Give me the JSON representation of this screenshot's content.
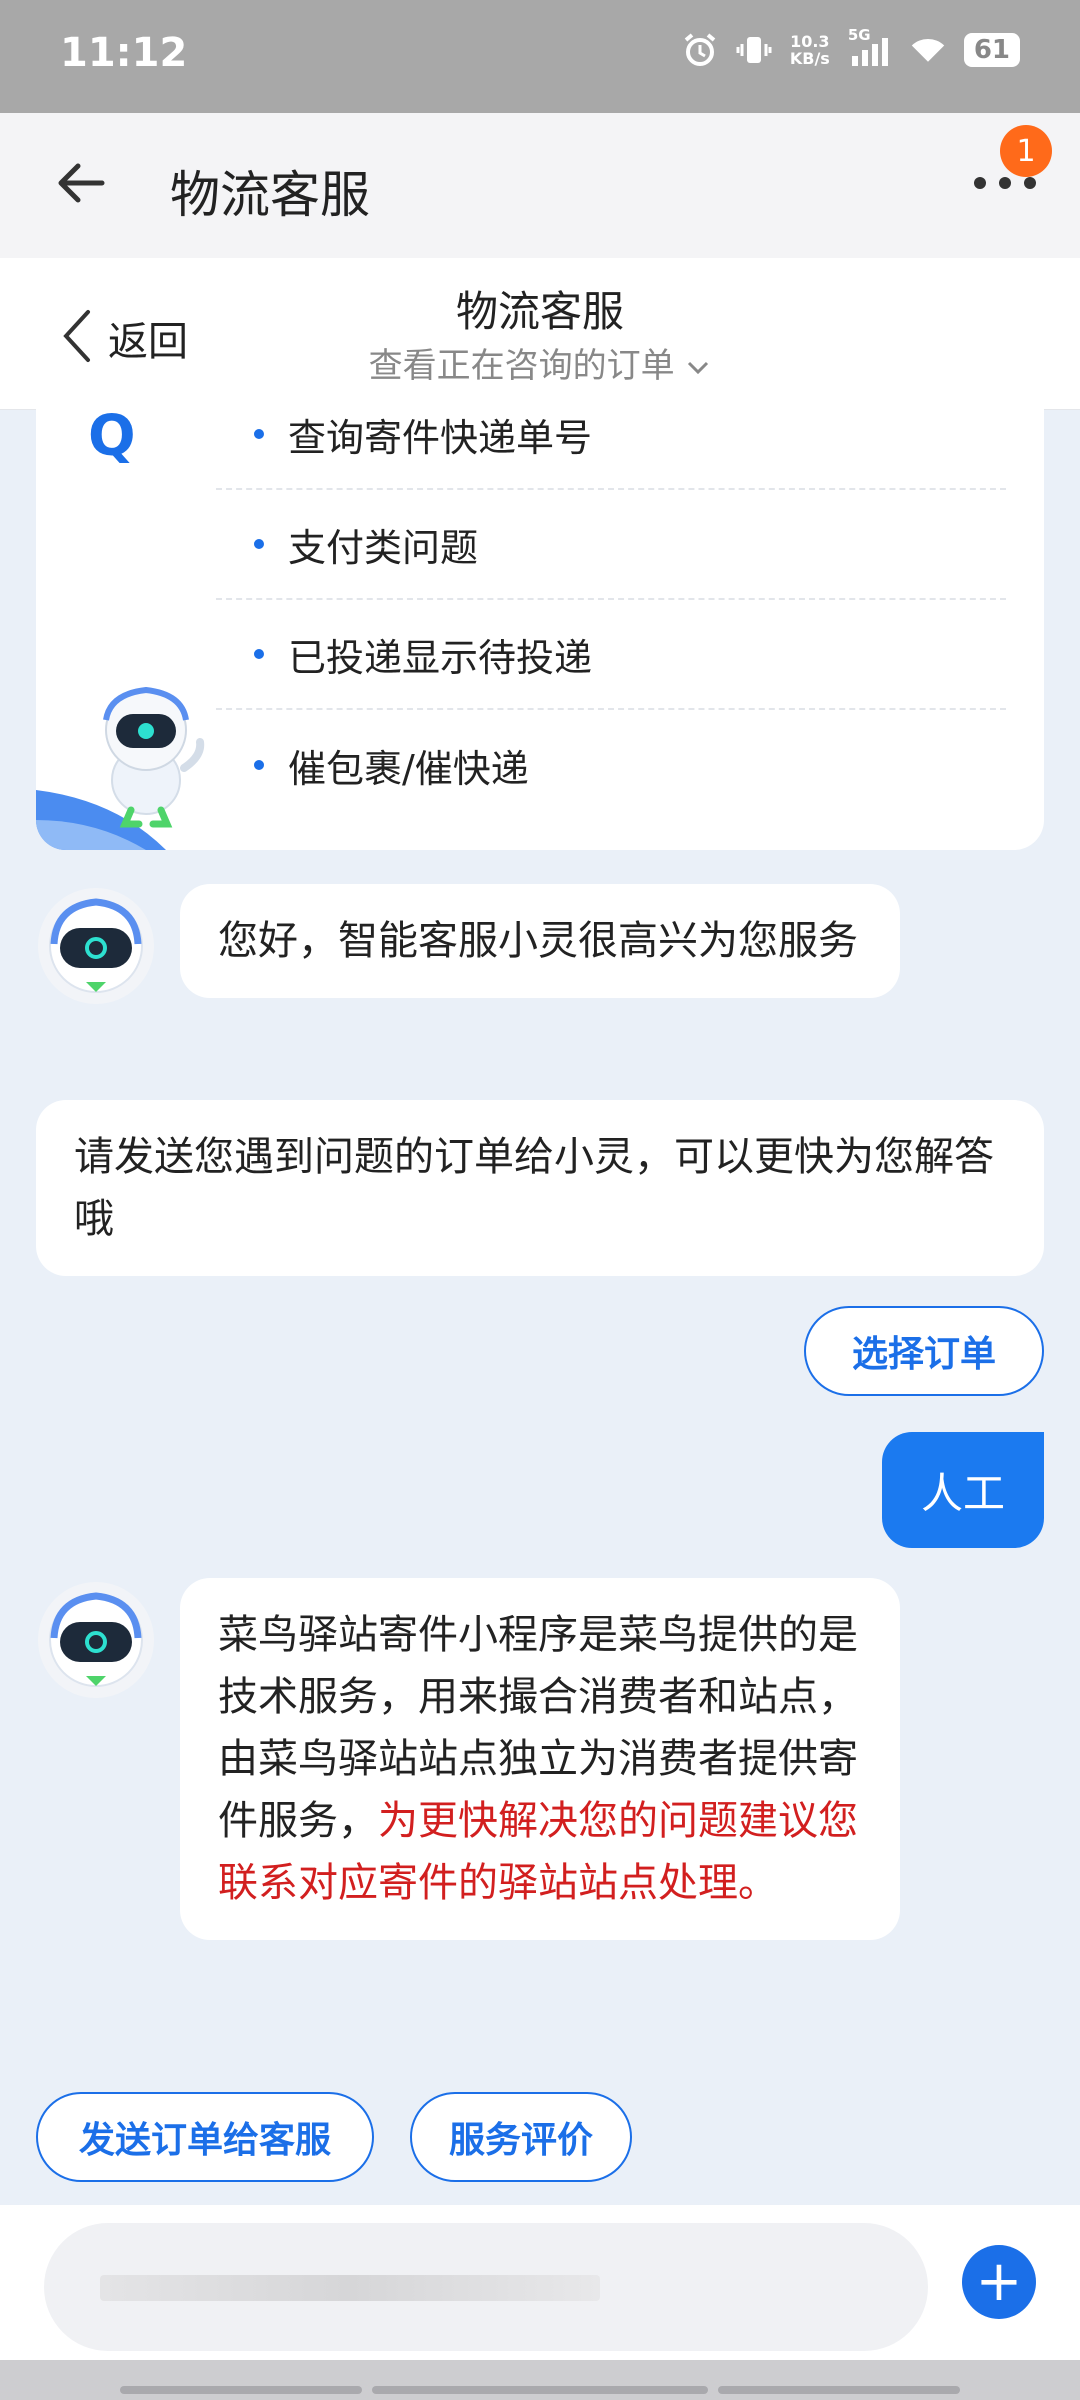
{
  "status_bar": {
    "time": "11:12",
    "net_speed_value": "10.3",
    "net_speed_unit": "KB/s",
    "network": "5G",
    "battery": "61"
  },
  "app_bar": {
    "title": "物流客服",
    "notification_count": "1"
  },
  "sub_header": {
    "back_label": "返回",
    "title": "物流客服",
    "subtitle": "查看正在咨询的订单"
  },
  "faq": {
    "q_mark": "Q",
    "items": [
      "查询寄件快递单号",
      "支付类问题",
      "已投递显示待投递",
      "催包裹/催快递"
    ]
  },
  "messages": {
    "greeting": "您好，智能客服小灵很高兴为您服务",
    "prompt": "请发送您遇到问题的订单给小灵，可以更快为您解答哦",
    "select_order_button": "选择订单",
    "user_message": "人工",
    "reply_normal": "菜鸟驿站寄件小程序是菜鸟提供的是技术服务，用来撮合消费者和站点，由菜鸟驿站站点独立为消费者提供寄件服务，",
    "reply_highlight": "为更快解决您的问题建议您联系对应寄件的驿站站点处理。"
  },
  "quick_actions": {
    "send_order": "发送订单给客服",
    "rate_service": "服务评价"
  },
  "colors": {
    "accent": "#1b6fe8",
    "highlight_red": "#d21f1f",
    "badge": "#ff6a1a"
  }
}
